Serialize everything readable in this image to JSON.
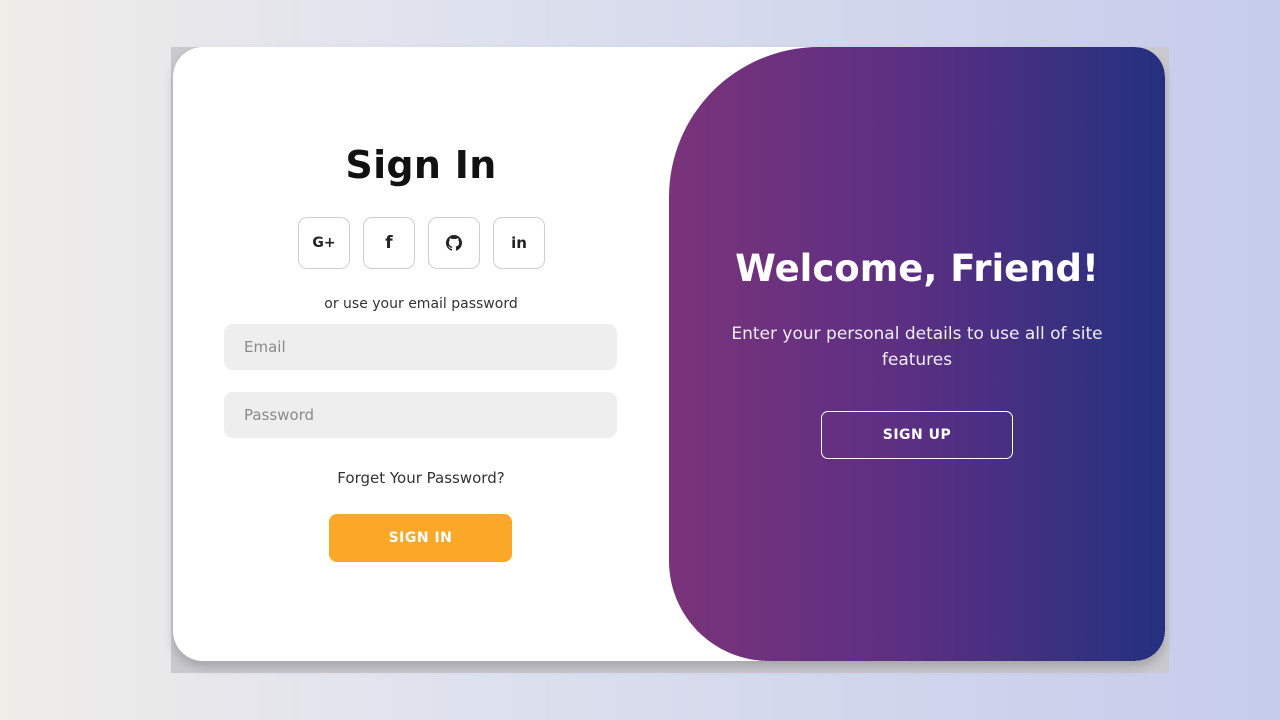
{
  "signin": {
    "title": "Sign In",
    "socials": [
      {
        "icon": "google-plus-icon",
        "label": "G+"
      },
      {
        "icon": "facebook-icon",
        "label": "f"
      },
      {
        "icon": "github-icon",
        "label": ""
      },
      {
        "icon": "linkedin-icon",
        "label": "in"
      }
    ],
    "divider_text": "or use your email password",
    "email_placeholder": "Email",
    "password_placeholder": "Password",
    "forgot_label": "Forget Your Password?",
    "button_label": "SIGN IN"
  },
  "welcome": {
    "title": "Welcome, Friend!",
    "text": "Enter your personal details to use all of site features",
    "button_label": "SIGN UP"
  },
  "colors": {
    "accent_orange": "#fba728",
    "gradient_start": "#7a3379",
    "gradient_end": "#24307f"
  }
}
